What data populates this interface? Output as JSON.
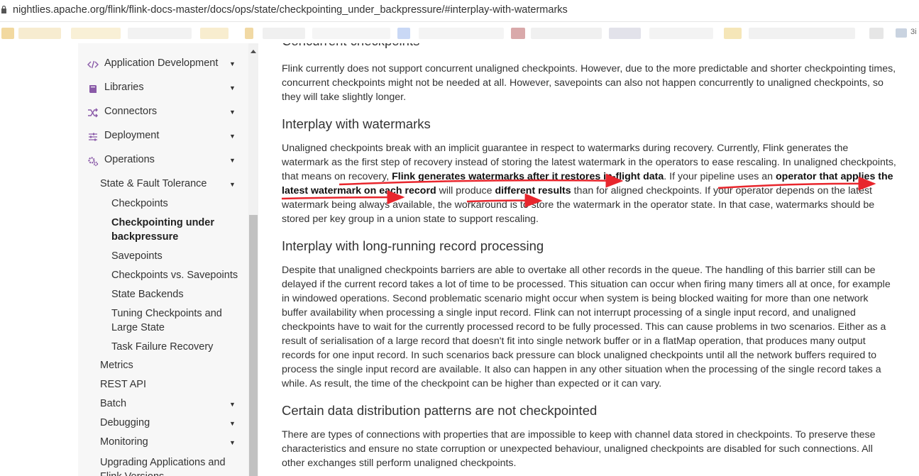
{
  "browser": {
    "url": "nightlies.apache.org/flink/flink-docs-master/docs/ops/state/checkpointing_under_backpressure/#interplay-with-watermarks",
    "bookmark_folder_label": "3i"
  },
  "sidebar": {
    "top_items": [
      {
        "label": "Application Development",
        "icon": "code-icon"
      },
      {
        "label": "Libraries",
        "icon": "book-icon"
      },
      {
        "label": "Connectors",
        "icon": "shuffle-icon"
      },
      {
        "label": "Deployment",
        "icon": "sliders-icon"
      },
      {
        "label": "Operations",
        "icon": "cogs-icon"
      }
    ],
    "state_section": "State & Fault Tolerance",
    "state_items": [
      "Checkpoints",
      "Checkpointing under backpressure",
      "Savepoints",
      "Checkpoints vs. Savepoints",
      "State Backends",
      "Tuning Checkpoints and Large State",
      "Task Failure Recovery"
    ],
    "ops_items": [
      "Metrics",
      "REST API",
      "Batch",
      "Debugging",
      "Monitoring",
      "Upgrading Applications and Flink Versions"
    ]
  },
  "content": {
    "prev_heading": "Concurrent checkpoints",
    "p_concurrent": "Flink currently does not support concurrent unaligned checkpoints. However, due to the more predictable and shorter checkpointing times, concurrent checkpoints might not be needed at all. However, savepoints can also not happen concurrently to unaligned checkpoints, so they will take slightly longer.",
    "h_watermarks": "Interplay with watermarks",
    "p_watermarks_1": "Unaligned checkpoints break with an implicit guarantee in respect to watermarks during recovery. Currently, Flink generates the watermark as the first step of recovery instead of storing the latest watermark in the operators to ease rescaling. In unaligned checkpoints, that means on recovery, ",
    "p_watermarks_b1": "Flink generates watermarks after it restores in-flight data",
    "p_watermarks_2": ". If your pipeline uses an ",
    "p_watermarks_b2": "operator that applies the latest watermark on each record",
    "p_watermarks_3": " will produce ",
    "p_watermarks_b3": "different results",
    "p_watermarks_4": " than for aligned checkpoints. If your operator depends on the latest watermark being always available, the workaround is to store the watermark in the operator state. In that case, watermarks should be stored per key group in a union state to support rescaling.",
    "h_long_running": "Interplay with long-running record processing",
    "p_long_running": "Despite that unaligned checkpoints barriers are able to overtake all other records in the queue. The handling of this barrier still can be delayed if the current record takes a lot of time to be processed. This situation can occur when firing many timers all at once, for example in windowed operations. Second problematic scenario might occur when system is being blocked waiting for more than one network buffer availability when processing a single input record. Flink can not interrupt processing of a single input record, and unaligned checkpoints have to wait for the currently processed record to be fully processed. This can cause problems in two scenarios. Either as a result of serialisation of a large record that doesn't fit into single network buffer or in a flatMap operation, that produces many output records for one input record. In such scenarios back pressure can block unaligned checkpoints until all the network buffers required to process the single input record are available. It also can happen in any other situation when the processing of the single record takes a while. As result, the time of the checkpoint can be higher than expected or it can vary.",
    "h_distribution": "Certain data distribution patterns are not checkpointed",
    "p_distribution": "There are types of connections with properties that are impossible to keep with channel data stored in checkpoints. To preserve these characteristics and ensure no state corruption or unexpected behaviour, unaligned checkpoints are disabled for such connections. All other exchanges still perform unaligned checkpoints."
  },
  "colors": {
    "sidebar_bg": "#f7f7f7",
    "icon_purple": "#8a5aa8",
    "annotation_red": "#e8262d"
  }
}
